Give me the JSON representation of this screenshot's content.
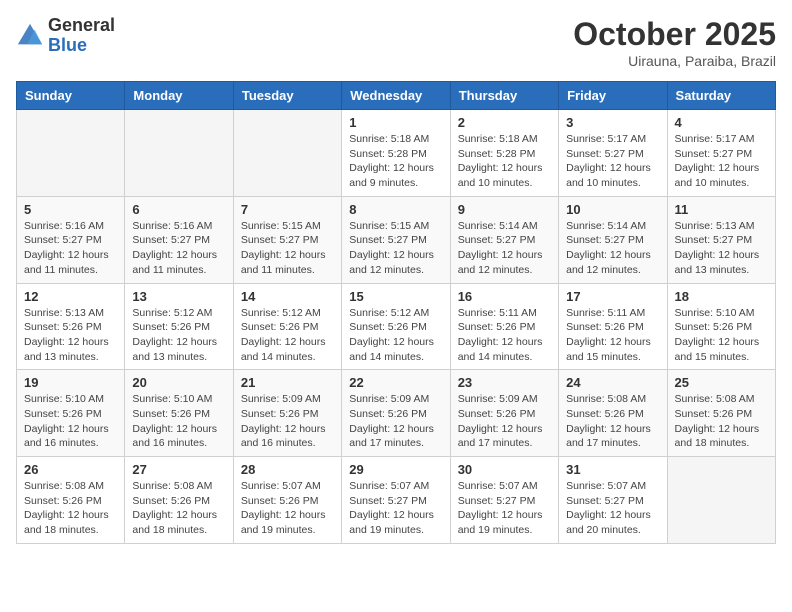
{
  "header": {
    "logo": {
      "line1": "General",
      "line2": "Blue"
    },
    "title": "October 2025",
    "subtitle": "Uirauna, Paraiba, Brazil"
  },
  "calendar": {
    "days_of_week": [
      "Sunday",
      "Monday",
      "Tuesday",
      "Wednesday",
      "Thursday",
      "Friday",
      "Saturday"
    ],
    "weeks": [
      [
        {
          "day": "",
          "info": ""
        },
        {
          "day": "",
          "info": ""
        },
        {
          "day": "",
          "info": ""
        },
        {
          "day": "1",
          "info": "Sunrise: 5:18 AM\nSunset: 5:28 PM\nDaylight: 12 hours and 9 minutes."
        },
        {
          "day": "2",
          "info": "Sunrise: 5:18 AM\nSunset: 5:28 PM\nDaylight: 12 hours and 10 minutes."
        },
        {
          "day": "3",
          "info": "Sunrise: 5:17 AM\nSunset: 5:27 PM\nDaylight: 12 hours and 10 minutes."
        },
        {
          "day": "4",
          "info": "Sunrise: 5:17 AM\nSunset: 5:27 PM\nDaylight: 12 hours and 10 minutes."
        }
      ],
      [
        {
          "day": "5",
          "info": "Sunrise: 5:16 AM\nSunset: 5:27 PM\nDaylight: 12 hours and 11 minutes."
        },
        {
          "day": "6",
          "info": "Sunrise: 5:16 AM\nSunset: 5:27 PM\nDaylight: 12 hours and 11 minutes."
        },
        {
          "day": "7",
          "info": "Sunrise: 5:15 AM\nSunset: 5:27 PM\nDaylight: 12 hours and 11 minutes."
        },
        {
          "day": "8",
          "info": "Sunrise: 5:15 AM\nSunset: 5:27 PM\nDaylight: 12 hours and 12 minutes."
        },
        {
          "day": "9",
          "info": "Sunrise: 5:14 AM\nSunset: 5:27 PM\nDaylight: 12 hours and 12 minutes."
        },
        {
          "day": "10",
          "info": "Sunrise: 5:14 AM\nSunset: 5:27 PM\nDaylight: 12 hours and 12 minutes."
        },
        {
          "day": "11",
          "info": "Sunrise: 5:13 AM\nSunset: 5:27 PM\nDaylight: 12 hours and 13 minutes."
        }
      ],
      [
        {
          "day": "12",
          "info": "Sunrise: 5:13 AM\nSunset: 5:26 PM\nDaylight: 12 hours and 13 minutes."
        },
        {
          "day": "13",
          "info": "Sunrise: 5:12 AM\nSunset: 5:26 PM\nDaylight: 12 hours and 13 minutes."
        },
        {
          "day": "14",
          "info": "Sunrise: 5:12 AM\nSunset: 5:26 PM\nDaylight: 12 hours and 14 minutes."
        },
        {
          "day": "15",
          "info": "Sunrise: 5:12 AM\nSunset: 5:26 PM\nDaylight: 12 hours and 14 minutes."
        },
        {
          "day": "16",
          "info": "Sunrise: 5:11 AM\nSunset: 5:26 PM\nDaylight: 12 hours and 14 minutes."
        },
        {
          "day": "17",
          "info": "Sunrise: 5:11 AM\nSunset: 5:26 PM\nDaylight: 12 hours and 15 minutes."
        },
        {
          "day": "18",
          "info": "Sunrise: 5:10 AM\nSunset: 5:26 PM\nDaylight: 12 hours and 15 minutes."
        }
      ],
      [
        {
          "day": "19",
          "info": "Sunrise: 5:10 AM\nSunset: 5:26 PM\nDaylight: 12 hours and 16 minutes."
        },
        {
          "day": "20",
          "info": "Sunrise: 5:10 AM\nSunset: 5:26 PM\nDaylight: 12 hours and 16 minutes."
        },
        {
          "day": "21",
          "info": "Sunrise: 5:09 AM\nSunset: 5:26 PM\nDaylight: 12 hours and 16 minutes."
        },
        {
          "day": "22",
          "info": "Sunrise: 5:09 AM\nSunset: 5:26 PM\nDaylight: 12 hours and 17 minutes."
        },
        {
          "day": "23",
          "info": "Sunrise: 5:09 AM\nSunset: 5:26 PM\nDaylight: 12 hours and 17 minutes."
        },
        {
          "day": "24",
          "info": "Sunrise: 5:08 AM\nSunset: 5:26 PM\nDaylight: 12 hours and 17 minutes."
        },
        {
          "day": "25",
          "info": "Sunrise: 5:08 AM\nSunset: 5:26 PM\nDaylight: 12 hours and 18 minutes."
        }
      ],
      [
        {
          "day": "26",
          "info": "Sunrise: 5:08 AM\nSunset: 5:26 PM\nDaylight: 12 hours and 18 minutes."
        },
        {
          "day": "27",
          "info": "Sunrise: 5:08 AM\nSunset: 5:26 PM\nDaylight: 12 hours and 18 minutes."
        },
        {
          "day": "28",
          "info": "Sunrise: 5:07 AM\nSunset: 5:26 PM\nDaylight: 12 hours and 19 minutes."
        },
        {
          "day": "29",
          "info": "Sunrise: 5:07 AM\nSunset: 5:27 PM\nDaylight: 12 hours and 19 minutes."
        },
        {
          "day": "30",
          "info": "Sunrise: 5:07 AM\nSunset: 5:27 PM\nDaylight: 12 hours and 19 minutes."
        },
        {
          "day": "31",
          "info": "Sunrise: 5:07 AM\nSunset: 5:27 PM\nDaylight: 12 hours and 20 minutes."
        },
        {
          "day": "",
          "info": ""
        }
      ]
    ]
  }
}
